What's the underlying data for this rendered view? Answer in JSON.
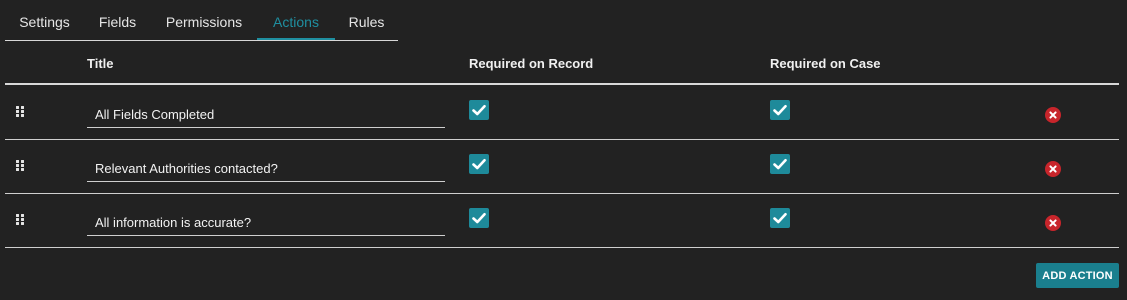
{
  "tabs": [
    {
      "label": "Settings",
      "active": false
    },
    {
      "label": "Fields",
      "active": false
    },
    {
      "label": "Permissions",
      "active": false
    },
    {
      "label": "Actions",
      "active": true
    },
    {
      "label": "Rules",
      "active": false
    }
  ],
  "table": {
    "headers": {
      "title": "Title",
      "required_on_record": "Required on Record",
      "required_on_case": "Required on Case"
    },
    "rows": [
      {
        "title": "All Fields Completed",
        "required_on_record": true,
        "required_on_case": true
      },
      {
        "title": "Relevant Authorities contacted?",
        "required_on_record": true,
        "required_on_case": true
      },
      {
        "title": "All information is accurate?",
        "required_on_record": true,
        "required_on_case": true
      }
    ]
  },
  "add_action_label": "ADD ACTION",
  "icons": {
    "drag_handle": "drag-handle-icon",
    "checkbox": "checkmark-icon",
    "delete": "close-circle-icon"
  },
  "colors": {
    "background": "#222222",
    "accent": "#1f8fa0",
    "checkbox": "#1e8a9a",
    "delete": "#c8252b",
    "button": "#1a7f8e"
  }
}
